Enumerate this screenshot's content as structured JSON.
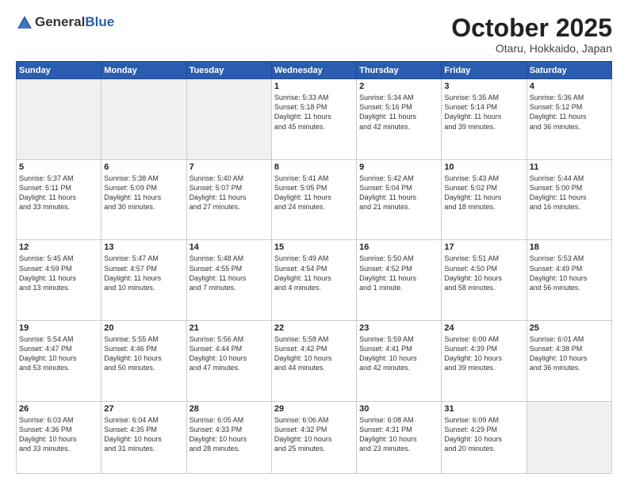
{
  "header": {
    "logo_general": "General",
    "logo_blue": "Blue",
    "month": "October 2025",
    "location": "Otaru, Hokkaido, Japan"
  },
  "weekdays": [
    "Sunday",
    "Monday",
    "Tuesday",
    "Wednesday",
    "Thursday",
    "Friday",
    "Saturday"
  ],
  "weeks": [
    [
      {
        "day": "",
        "info": "",
        "empty": true
      },
      {
        "day": "",
        "info": "",
        "empty": true
      },
      {
        "day": "",
        "info": "",
        "empty": true
      },
      {
        "day": "1",
        "info": "Sunrise: 5:33 AM\nSunset: 5:18 PM\nDaylight: 11 hours\nand 45 minutes.",
        "empty": false
      },
      {
        "day": "2",
        "info": "Sunrise: 5:34 AM\nSunset: 5:16 PM\nDaylight: 11 hours\nand 42 minutes.",
        "empty": false
      },
      {
        "day": "3",
        "info": "Sunrise: 5:35 AM\nSunset: 5:14 PM\nDaylight: 11 hours\nand 39 minutes.",
        "empty": false
      },
      {
        "day": "4",
        "info": "Sunrise: 5:36 AM\nSunset: 5:12 PM\nDaylight: 11 hours\nand 36 minutes.",
        "empty": false
      }
    ],
    [
      {
        "day": "5",
        "info": "Sunrise: 5:37 AM\nSunset: 5:11 PM\nDaylight: 11 hours\nand 33 minutes.",
        "empty": false
      },
      {
        "day": "6",
        "info": "Sunrise: 5:38 AM\nSunset: 5:09 PM\nDaylight: 11 hours\nand 30 minutes.",
        "empty": false
      },
      {
        "day": "7",
        "info": "Sunrise: 5:40 AM\nSunset: 5:07 PM\nDaylight: 11 hours\nand 27 minutes.",
        "empty": false
      },
      {
        "day": "8",
        "info": "Sunrise: 5:41 AM\nSunset: 5:05 PM\nDaylight: 11 hours\nand 24 minutes.",
        "empty": false
      },
      {
        "day": "9",
        "info": "Sunrise: 5:42 AM\nSunset: 5:04 PM\nDaylight: 11 hours\nand 21 minutes.",
        "empty": false
      },
      {
        "day": "10",
        "info": "Sunrise: 5:43 AM\nSunset: 5:02 PM\nDaylight: 11 hours\nand 18 minutes.",
        "empty": false
      },
      {
        "day": "11",
        "info": "Sunrise: 5:44 AM\nSunset: 5:00 PM\nDaylight: 11 hours\nand 16 minutes.",
        "empty": false
      }
    ],
    [
      {
        "day": "12",
        "info": "Sunrise: 5:45 AM\nSunset: 4:59 PM\nDaylight: 11 hours\nand 13 minutes.",
        "empty": false
      },
      {
        "day": "13",
        "info": "Sunrise: 5:47 AM\nSunset: 4:57 PM\nDaylight: 11 hours\nand 10 minutes.",
        "empty": false
      },
      {
        "day": "14",
        "info": "Sunrise: 5:48 AM\nSunset: 4:55 PM\nDaylight: 11 hours\nand 7 minutes.",
        "empty": false
      },
      {
        "day": "15",
        "info": "Sunrise: 5:49 AM\nSunset: 4:54 PM\nDaylight: 11 hours\nand 4 minutes.",
        "empty": false
      },
      {
        "day": "16",
        "info": "Sunrise: 5:50 AM\nSunset: 4:52 PM\nDaylight: 11 hours\nand 1 minute.",
        "empty": false
      },
      {
        "day": "17",
        "info": "Sunrise: 5:51 AM\nSunset: 4:50 PM\nDaylight: 10 hours\nand 58 minutes.",
        "empty": false
      },
      {
        "day": "18",
        "info": "Sunrise: 5:53 AM\nSunset: 4:49 PM\nDaylight: 10 hours\nand 56 minutes.",
        "empty": false
      }
    ],
    [
      {
        "day": "19",
        "info": "Sunrise: 5:54 AM\nSunset: 4:47 PM\nDaylight: 10 hours\nand 53 minutes.",
        "empty": false
      },
      {
        "day": "20",
        "info": "Sunrise: 5:55 AM\nSunset: 4:46 PM\nDaylight: 10 hours\nand 50 minutes.",
        "empty": false
      },
      {
        "day": "21",
        "info": "Sunrise: 5:56 AM\nSunset: 4:44 PM\nDaylight: 10 hours\nand 47 minutes.",
        "empty": false
      },
      {
        "day": "22",
        "info": "Sunrise: 5:58 AM\nSunset: 4:42 PM\nDaylight: 10 hours\nand 44 minutes.",
        "empty": false
      },
      {
        "day": "23",
        "info": "Sunrise: 5:59 AM\nSunset: 4:41 PM\nDaylight: 10 hours\nand 42 minutes.",
        "empty": false
      },
      {
        "day": "24",
        "info": "Sunrise: 6:00 AM\nSunset: 4:39 PM\nDaylight: 10 hours\nand 39 minutes.",
        "empty": false
      },
      {
        "day": "25",
        "info": "Sunrise: 6:01 AM\nSunset: 4:38 PM\nDaylight: 10 hours\nand 36 minutes.",
        "empty": false
      }
    ],
    [
      {
        "day": "26",
        "info": "Sunrise: 6:03 AM\nSunset: 4:36 PM\nDaylight: 10 hours\nand 33 minutes.",
        "empty": false
      },
      {
        "day": "27",
        "info": "Sunrise: 6:04 AM\nSunset: 4:35 PM\nDaylight: 10 hours\nand 31 minutes.",
        "empty": false
      },
      {
        "day": "28",
        "info": "Sunrise: 6:05 AM\nSunset: 4:33 PM\nDaylight: 10 hours\nand 28 minutes.",
        "empty": false
      },
      {
        "day": "29",
        "info": "Sunrise: 6:06 AM\nSunset: 4:32 PM\nDaylight: 10 hours\nand 25 minutes.",
        "empty": false
      },
      {
        "day": "30",
        "info": "Sunrise: 6:08 AM\nSunset: 4:31 PM\nDaylight: 10 hours\nand 23 minutes.",
        "empty": false
      },
      {
        "day": "31",
        "info": "Sunrise: 6:09 AM\nSunset: 4:29 PM\nDaylight: 10 hours\nand 20 minutes.",
        "empty": false
      },
      {
        "day": "",
        "info": "",
        "empty": true
      }
    ]
  ]
}
